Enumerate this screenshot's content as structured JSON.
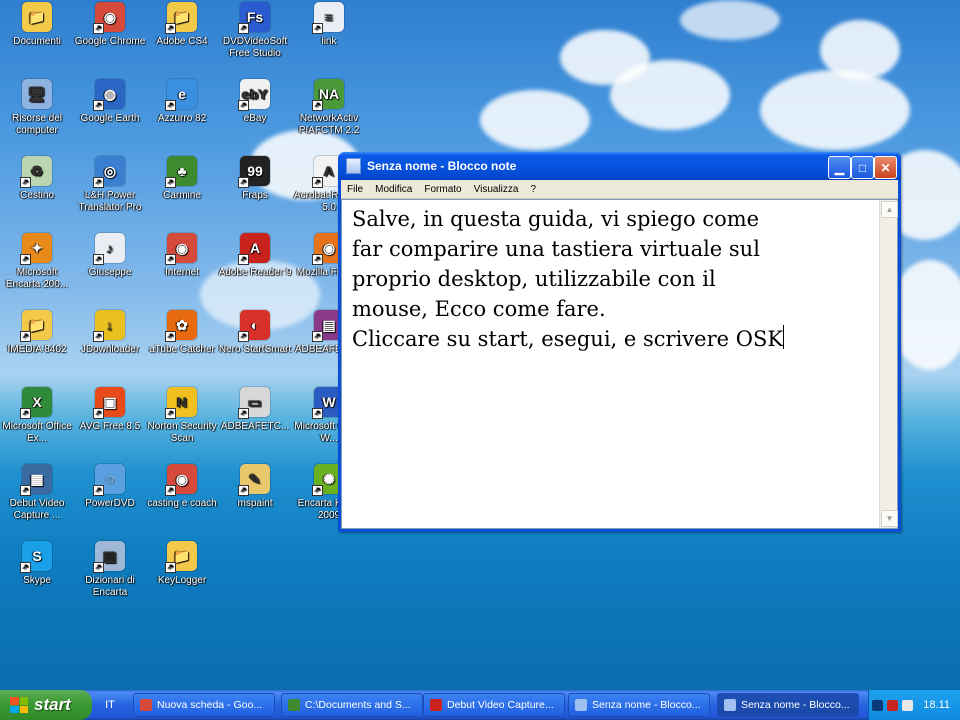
{
  "desktop_icons": [
    {
      "label": "Documenti",
      "glyph": "folder-icon",
      "color": "#f3c94a",
      "symbol": "📁"
    },
    {
      "label": "Google Chrome",
      "glyph": "chrome-icon",
      "color": "#d64a3b",
      "symbol": "◉"
    },
    {
      "label": "Adobe CS4",
      "glyph": "folder-icon",
      "color": "#f3c94a",
      "symbol": "📁"
    },
    {
      "label": "DVDVideoSoft Free Studio",
      "glyph": "dvdvideosoft-icon",
      "color": "#2a5bd0",
      "symbol": "Fs"
    },
    {
      "label": "link",
      "glyph": "text-file-icon",
      "color": "#e9eef5",
      "symbol": "≡"
    },
    {
      "label": "Risorse del computer",
      "glyph": "computer-icon",
      "color": "#8fb3e0",
      "symbol": "🖥"
    },
    {
      "label": "Google Earth",
      "glyph": "google-earth-icon",
      "color": "#2b66c5",
      "symbol": "◍"
    },
    {
      "label": "Azzurro 82",
      "glyph": "ie-icon",
      "color": "#3a8fe0",
      "symbol": "e"
    },
    {
      "label": "eBay",
      "glyph": "ebay-icon",
      "color": "#f0f0f0",
      "symbol": "ebY"
    },
    {
      "label": "NetworkActiv PIAFCTM 2.2",
      "glyph": "network-icon",
      "color": "#4a9a3a",
      "symbol": "NA"
    },
    {
      "label": "Cestino",
      "glyph": "recycle-bin-icon",
      "color": "#b9d6b0",
      "symbol": "♻"
    },
    {
      "label": "L&H Power Translator Pro",
      "glyph": "globe-icon",
      "color": "#3a7fd0",
      "symbol": "◎"
    },
    {
      "label": "Carmine",
      "glyph": "tree-icon",
      "color": "#3d8a2f",
      "symbol": "♣"
    },
    {
      "label": "Fraps",
      "glyph": "fraps-icon",
      "color": "#222222",
      "symbol": "99"
    },
    {
      "label": "Acrobat Reader 5.0",
      "glyph": "acrobat-icon",
      "color": "#f2f2f2",
      "symbol": "A"
    },
    {
      "label": "Microsoft Encarta 200...",
      "glyph": "encarta-icon",
      "color": "#e88a1a",
      "symbol": "✦"
    },
    {
      "label": "Giuseppe",
      "glyph": "music-icon",
      "color": "#e9eef5",
      "symbol": "♪"
    },
    {
      "label": "Internet",
      "glyph": "chrome-icon",
      "color": "#d64a3b",
      "symbol": "◉"
    },
    {
      "label": "Adobe Reader 9",
      "glyph": "adobe-reader-icon",
      "color": "#c8231c",
      "symbol": "A"
    },
    {
      "label": "Mozilla Firefox",
      "glyph": "firefox-icon",
      "color": "#e4731b",
      "symbol": "◉"
    },
    {
      "label": "IMEDIA 8402",
      "glyph": "folder-icon",
      "color": "#f3c94a",
      "symbol": "📁"
    },
    {
      "label": "JDownloader",
      "glyph": "jdownloader-icon",
      "color": "#e8c020",
      "symbol": "↓"
    },
    {
      "label": "aTube Catcher",
      "glyph": "atube-icon",
      "color": "#e86a10",
      "symbol": "✿"
    },
    {
      "label": "Nero StartSmart",
      "glyph": "nero-icon",
      "color": "#d8302a",
      "symbol": "◐"
    },
    {
      "label": "ADBEAFETC...",
      "glyph": "archive-icon",
      "color": "#8a3a8a",
      "symbol": "▤"
    },
    {
      "label": "Microsoft Office Ex...",
      "glyph": "excel-icon",
      "color": "#2f8a3a",
      "symbol": "X"
    },
    {
      "label": "AVG Free 8.5",
      "glyph": "avg-icon",
      "color": "#e84a1a",
      "symbol": "▣"
    },
    {
      "label": "Norton Security Scan",
      "glyph": "norton-icon",
      "color": "#f0c020",
      "symbol": "N"
    },
    {
      "label": "ADBEAFETC...",
      "glyph": "adobe-file-icon",
      "color": "#d8d8d8",
      "symbol": "▭"
    },
    {
      "label": "Microsoft Office W...",
      "glyph": "word-icon",
      "color": "#2a5bc0",
      "symbol": "W"
    },
    {
      "label": "Debut Video Capture ...",
      "glyph": "debut-icon",
      "color": "#3a6aa0",
      "symbol": "▦"
    },
    {
      "label": "PowerDVD",
      "glyph": "powerdvd-icon",
      "color": "#5aa0e0",
      "symbol": "◌"
    },
    {
      "label": "casting e coach",
      "glyph": "chrome-icon",
      "color": "#d64a3b",
      "symbol": "◉"
    },
    {
      "label": "mspaint",
      "glyph": "paint-icon",
      "color": "#e8c86a",
      "symbol": "✎"
    },
    {
      "label": "Encarta Kids - 2009",
      "glyph": "encarta-kids-icon",
      "color": "#6ab020",
      "symbol": "✺"
    },
    {
      "label": "Skype",
      "glyph": "skype-icon",
      "color": "#1aa0e8",
      "symbol": "S"
    },
    {
      "label": "Dizionari di Encarta",
      "glyph": "book-icon",
      "color": "#9fb8d8",
      "symbol": "▥"
    },
    {
      "label": "KeyLogger",
      "glyph": "folder-icon",
      "color": "#f3c94a",
      "symbol": "📁"
    }
  ],
  "notepad": {
    "title": "Senza nome - Blocco note",
    "menu": [
      "File",
      "Modifica",
      "Formato",
      "Visualizza",
      "?"
    ],
    "content": "Salve, in questa guida, vi spiego come\nfar comparire una tastiera virtuale sul\nproprio desktop, utilizzabile con il\nmouse, Ecco come fare.\nCliccare su start, esegui, e scrivere OSK"
  },
  "taskbar": {
    "start_label": "start",
    "language": "IT",
    "tasks": [
      {
        "label": "Nuova scheda - Goo...",
        "icon_color": "#d64a3b",
        "active": false
      },
      {
        "label": "C:\\Documents and S...",
        "icon_color": "#3d8a2f",
        "active": false
      },
      {
        "label": "Debut Video Capture...",
        "icon_color": "#c8231c",
        "active": false
      },
      {
        "label": "Senza nome - Blocco...",
        "icon_color": "#9fc0f0",
        "active": false
      },
      {
        "label": "Senza nome - Blocco...",
        "icon_color": "#9fc0f0",
        "active": true
      }
    ],
    "clock": "18.11"
  }
}
